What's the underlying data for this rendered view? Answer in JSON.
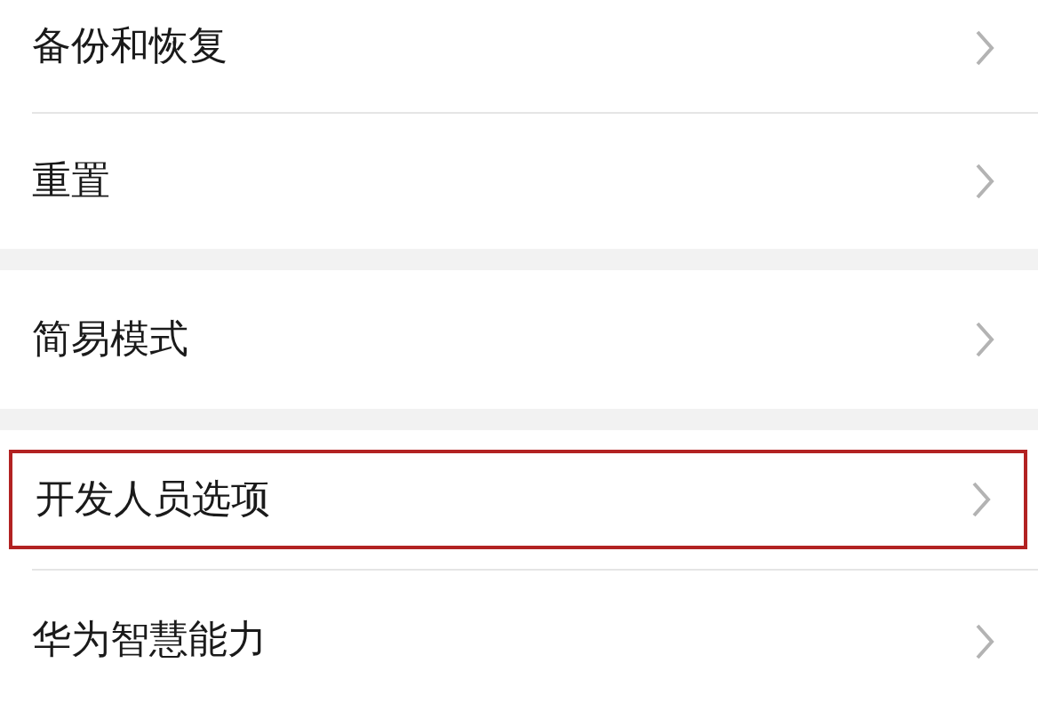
{
  "groups": [
    {
      "items": [
        {
          "label": "备份和恢复",
          "highlighted": false
        },
        {
          "label": "重置",
          "highlighted": false
        }
      ]
    },
    {
      "items": [
        {
          "label": "简易模式",
          "highlighted": false
        }
      ]
    },
    {
      "items": [
        {
          "label": "开发人员选项",
          "highlighted": true
        },
        {
          "label": "华为智慧能力",
          "highlighted": false
        }
      ]
    }
  ]
}
